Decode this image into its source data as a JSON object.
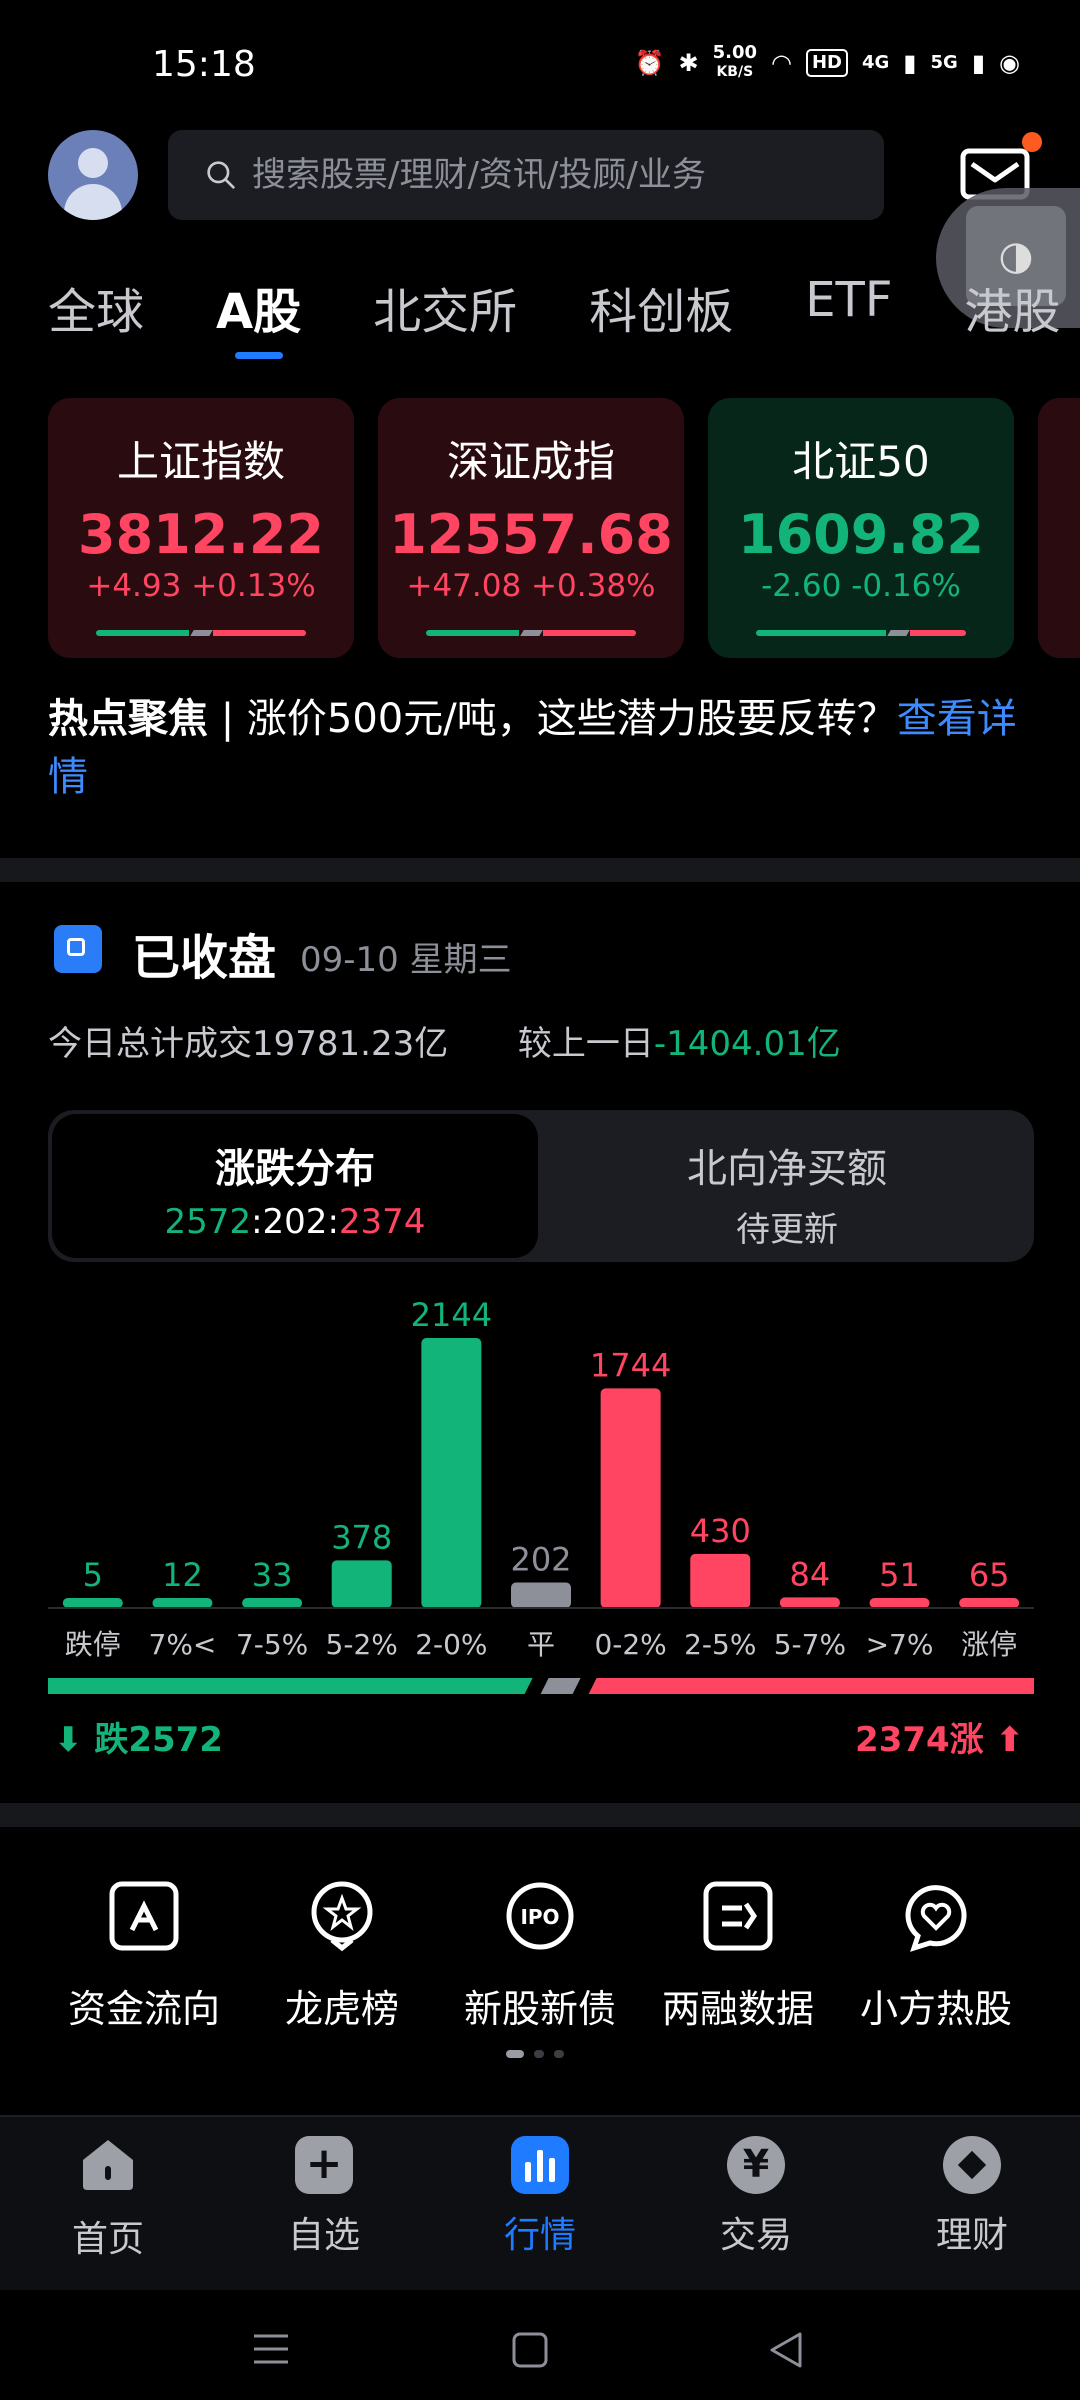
{
  "status_bar": {
    "time": "15:18",
    "speed_value": "5.00",
    "speed_unit": "KB/S",
    "hd_badge": "HD",
    "net1": "4G",
    "net2": "5G"
  },
  "search": {
    "placeholder": "搜索股票/理财/资讯/投顾/业务"
  },
  "floating_button": {
    "symbol": "◑"
  },
  "tabs": [
    {
      "label": "全球"
    },
    {
      "label": "A股"
    },
    {
      "label": "北交所"
    },
    {
      "label": "科创板"
    },
    {
      "label": "ETF"
    },
    {
      "label": "港股"
    }
  ],
  "active_tab": "A股",
  "indices": [
    {
      "name": "上证指数",
      "value": "3812.22",
      "change": "+4.93 +0.13%",
      "trend": "up"
    },
    {
      "name": "深证成指",
      "value": "12557.68",
      "change": "+47.08 +0.38%",
      "trend": "up"
    },
    {
      "name": "北证50",
      "value": "1609.82",
      "change": "-2.60 -0.16%",
      "trend": "down"
    }
  ],
  "news": {
    "tag": "热点聚焦",
    "separator": " | ",
    "text": "涨价500元/吨，这些潜力股要反转？",
    "link": "查看详情"
  },
  "market": {
    "status": "已收盘",
    "date": "09-10 星期三",
    "turnover_label": "今日总计成交",
    "turnover_value": "19781.23亿",
    "compare_label": "较上一日",
    "compare_value": "-1404.01亿"
  },
  "segment": {
    "left_title": "涨跌分布",
    "left_down": "2572",
    "left_flat": "202",
    "left_up": "2374",
    "colon": ":",
    "right_title": "北向净买额",
    "right_sub": "待更新"
  },
  "chart_data": {
    "type": "bar",
    "categories": [
      "跌停",
      "7%<",
      "7-5%",
      "5-2%",
      "2-0%",
      "平",
      "0-2%",
      "2-5%",
      "5-7%",
      ">7%",
      "涨停"
    ],
    "values": [
      5,
      12,
      33,
      378,
      2144,
      202,
      1744,
      430,
      84,
      51,
      65
    ],
    "colors": [
      "green",
      "green",
      "green",
      "green",
      "green",
      "gray",
      "red",
      "red",
      "red",
      "red",
      "red"
    ]
  },
  "legend": {
    "down_label": "跌2572",
    "up_label": "2374涨",
    "down_count": 2572,
    "flat_count": 202,
    "up_count": 2374
  },
  "tools": [
    {
      "label": "资金流向",
      "icon": "fund-flow-icon"
    },
    {
      "label": "龙虎榜",
      "icon": "dragon-tiger-icon"
    },
    {
      "label": "新股新债",
      "icon": "ipo-icon"
    },
    {
      "label": "两融数据",
      "icon": "margin-data-icon"
    },
    {
      "label": "小方热股",
      "icon": "hot-stock-icon"
    }
  ],
  "nav": [
    {
      "label": "首页"
    },
    {
      "label": "自选"
    },
    {
      "label": "行情"
    },
    {
      "label": "交易"
    },
    {
      "label": "理财"
    }
  ],
  "active_nav": "行情",
  "colors": {
    "up": "#ff4561",
    "down": "#12b47a",
    "flat": "#8d9099",
    "accent": "#1f7bff"
  }
}
